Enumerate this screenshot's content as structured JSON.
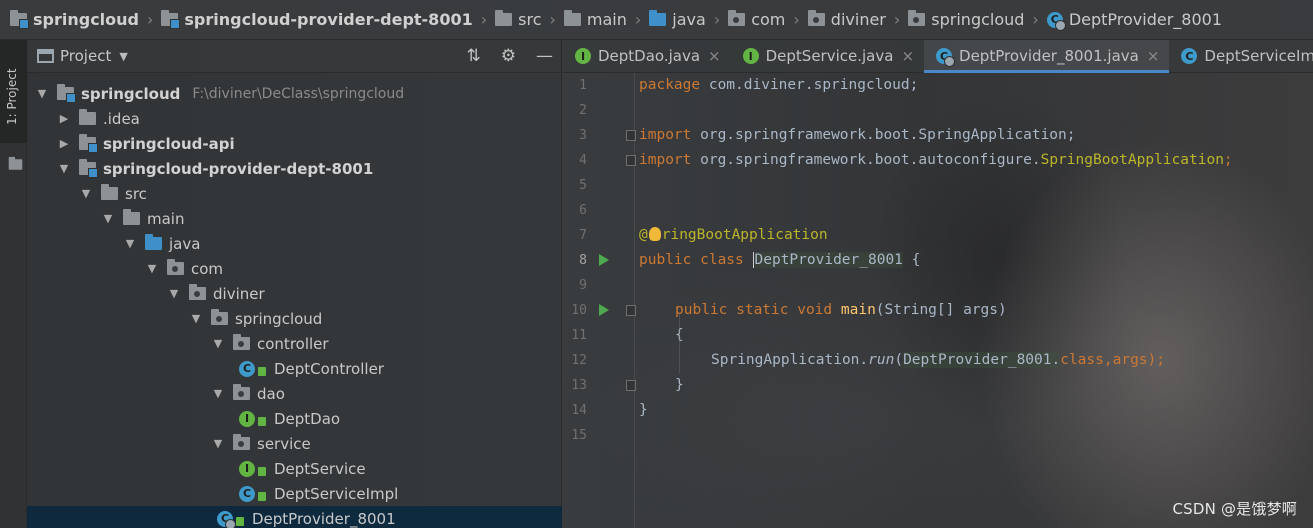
{
  "breadcrumbs": [
    {
      "label": "springcloud",
      "icon": "module-folder-icon",
      "bold": true
    },
    {
      "label": "springcloud-provider-dept-8001",
      "icon": "module-folder-icon",
      "bold": true
    },
    {
      "label": "src",
      "icon": "folder-icon",
      "bold": false
    },
    {
      "label": "main",
      "icon": "folder-icon",
      "bold": false
    },
    {
      "label": "java",
      "icon": "source-folder-icon",
      "bold": false
    },
    {
      "label": "com",
      "icon": "package-icon",
      "bold": false
    },
    {
      "label": "diviner",
      "icon": "package-icon",
      "bold": false
    },
    {
      "label": "springcloud",
      "icon": "package-icon",
      "bold": false
    },
    {
      "label": "DeptProvider_8001",
      "icon": "spring-boot-class-icon",
      "bold": false
    }
  ],
  "strip": {
    "tab_label": "1: Project"
  },
  "panel": {
    "title": "Project"
  },
  "tree": [
    {
      "label": "springcloud",
      "path": "F:\\diviner\\DeClass\\springcloud",
      "depth": 0,
      "expanded": true,
      "type": "module",
      "bold": true
    },
    {
      "label": ".idea",
      "depth": 1,
      "expanded": false,
      "type": "folder"
    },
    {
      "label": "springcloud-api",
      "depth": 1,
      "expanded": false,
      "type": "module",
      "bold": true
    },
    {
      "label": "springcloud-provider-dept-8001",
      "depth": 1,
      "expanded": true,
      "type": "module",
      "bold": true
    },
    {
      "label": "src",
      "depth": 2,
      "expanded": true,
      "type": "folder"
    },
    {
      "label": "main",
      "depth": 3,
      "expanded": true,
      "type": "folder"
    },
    {
      "label": "java",
      "depth": 4,
      "expanded": true,
      "type": "source"
    },
    {
      "label": "com",
      "depth": 5,
      "expanded": true,
      "type": "package"
    },
    {
      "label": "diviner",
      "depth": 6,
      "expanded": true,
      "type": "package"
    },
    {
      "label": "springcloud",
      "depth": 7,
      "expanded": true,
      "type": "package"
    },
    {
      "label": "controller",
      "depth": 8,
      "expanded": true,
      "type": "package"
    },
    {
      "label": "DeptController",
      "depth": 9,
      "type": "class"
    },
    {
      "label": "dao",
      "depth": 8,
      "expanded": true,
      "type": "package"
    },
    {
      "label": "DeptDao",
      "depth": 9,
      "type": "interface"
    },
    {
      "label": "service",
      "depth": 8,
      "expanded": true,
      "type": "package"
    },
    {
      "label": "DeptService",
      "depth": 9,
      "type": "interface"
    },
    {
      "label": "DeptServiceImpl",
      "depth": 9,
      "type": "class"
    },
    {
      "label": "DeptProvider_8001",
      "depth": 8,
      "type": "boot",
      "selected": true
    }
  ],
  "tabs": [
    {
      "label": "DeptDao.java",
      "type": "interface",
      "active": false
    },
    {
      "label": "DeptService.java",
      "type": "interface",
      "active": false
    },
    {
      "label": "DeptProvider_8001.java",
      "type": "boot",
      "active": true
    },
    {
      "label": "DeptServiceImpl.java",
      "type": "class",
      "active": false
    }
  ],
  "code": {
    "line_numbers": [
      "1",
      "2",
      "3",
      "4",
      "5",
      "6",
      "7",
      "8",
      "9",
      "10",
      "11",
      "12",
      "13",
      "14",
      "15"
    ],
    "current_line": 8,
    "run_lines": [
      8,
      10
    ],
    "fold_lines": [
      3,
      4,
      10,
      13
    ],
    "lines": {
      "l1": {
        "kw": "package",
        "rest": " com.diviner.springcloud;"
      },
      "l3": {
        "kw": "import",
        "rest": " org.springframework.boot.SpringApplication;"
      },
      "l4": {
        "kw": "import",
        "rest": " org.springframework.boot.autoconfigure.",
        "ann": "SpringBootApplication",
        "end": ";"
      },
      "l7": {
        "ann_a": "@",
        "ann_b": "ringBootApplication"
      },
      "l8": {
        "kw": "public class",
        "space": " ",
        "cls": "DeptProvider_8001",
        "end": " {"
      },
      "l10": {
        "kw": "public static void",
        "space": " ",
        "fn": "main",
        "rest": "(String[] args)"
      },
      "l11": {
        "text": "{"
      },
      "l12": {
        "a": "SpringApplication.",
        "b": "run",
        "c": "(",
        "d": "DeptProvider_8001.",
        "e": "class",
        "f": ",args);"
      },
      "l13": {
        "text": "}"
      },
      "l14": {
        "text": "}"
      }
    }
  },
  "watermark": "CSDN @是饿梦啊"
}
